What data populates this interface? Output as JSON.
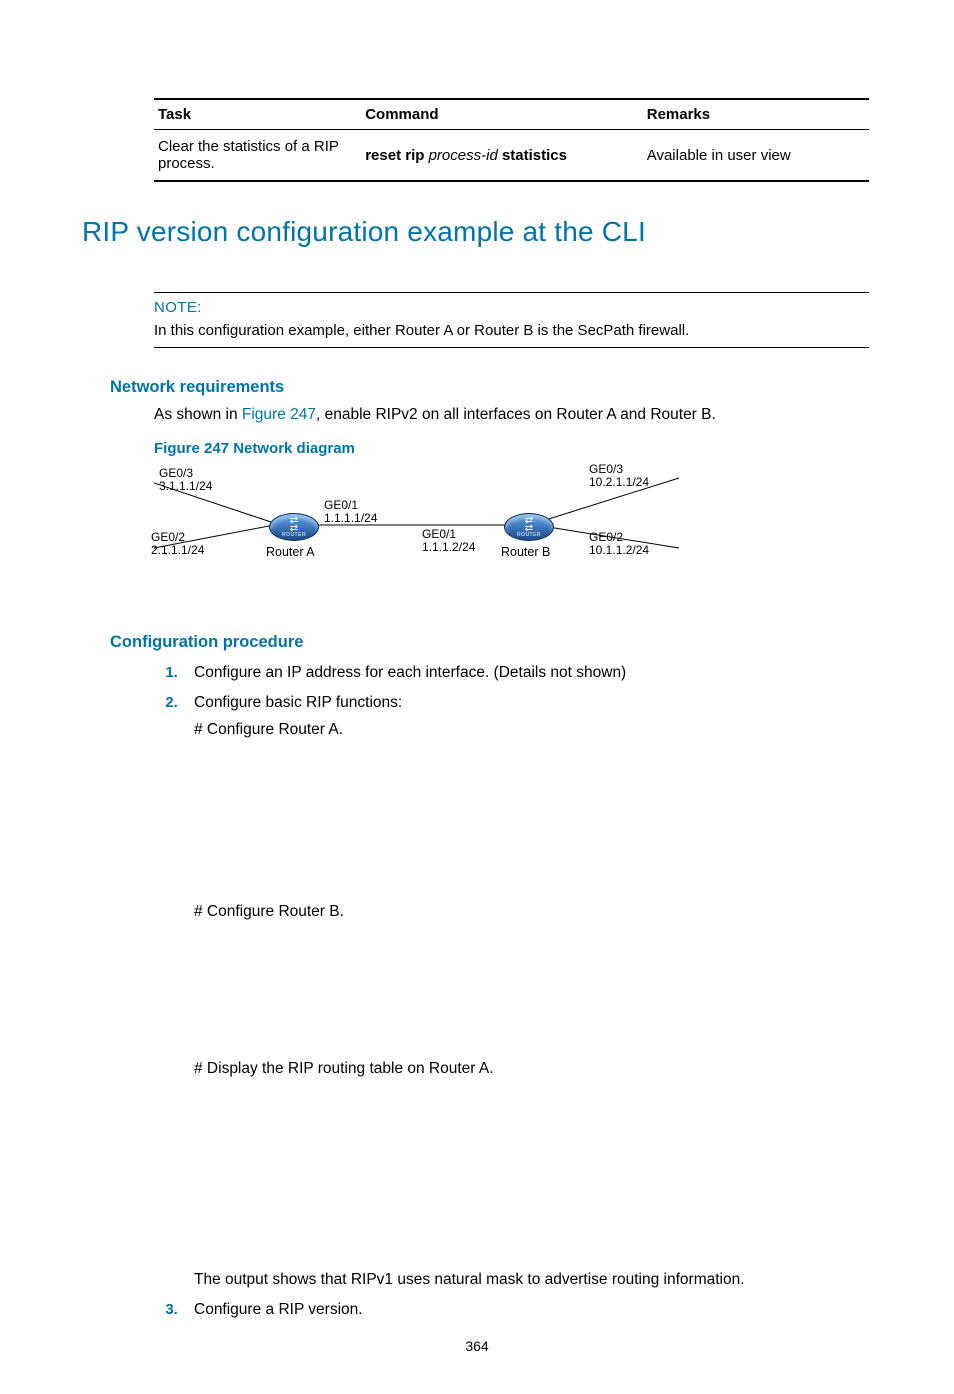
{
  "table": {
    "headers": [
      "Task",
      "Command",
      "Remarks"
    ],
    "row": {
      "task": "Clear the statistics of a RIP process.",
      "cmd_plain1": "reset rip ",
      "cmd_arg": "process-id",
      "cmd_plain2": " statistics",
      "remarks": "Available in user view"
    }
  },
  "h1": "RIP version configuration example at the CLI",
  "note": {
    "label": "NOTE:",
    "text": "In this configuration example, either Router A or Router B is the SecPath firewall."
  },
  "net_req": {
    "heading": "Network requirements",
    "text_pre": "As shown in ",
    "figref": "Figure 247",
    "text_post": ", enable RIPv2 on all interfaces on Router A and Router B.",
    "fig_caption": "Figure 247 Network diagram"
  },
  "diagram": {
    "routerA": "Router A",
    "routerB": "Router B",
    "a_ge03": "GE0/3",
    "a_ge03_ip": "3.1.1.1/24",
    "a_ge02": "GE0/2",
    "a_ge02_ip": "2.1.1.1/24",
    "a_ge01": "GE0/1",
    "a_ge01_ip": "1.1.1.1/24",
    "b_ge01": "GE0/1",
    "b_ge01_ip": "1.1.1.2/24",
    "b_ge03": "GE0/3",
    "b_ge03_ip": "10.2.1.1/24",
    "b_ge02": "GE0/2",
    "b_ge02_ip": "10.1.1.2/24"
  },
  "proc": {
    "heading": "Configuration procedure",
    "step1": "Configure an IP address for each interface. (Details not shown)",
    "step2": "Configure basic RIP functions:",
    "step2a": "# Configure Router A.",
    "step2b": "# Configure Router B.",
    "step2c": "# Display the RIP routing table on Router A.",
    "step2d": "The output shows that RIPv1 uses natural mask to advertise routing information.",
    "step3": "Configure a RIP version."
  },
  "page_num": "364"
}
